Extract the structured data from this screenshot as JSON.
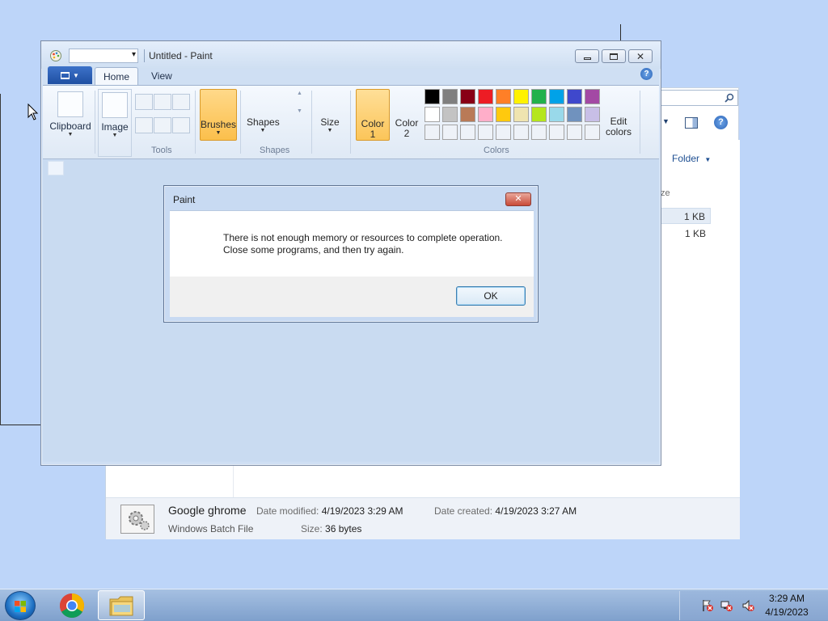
{
  "explorer": {
    "folder_label": "Folder",
    "column_size": "ze",
    "rows": [
      {
        "size": "1 KB",
        "selected": true
      },
      {
        "size": "1 KB",
        "selected": false
      }
    ],
    "details": {
      "name": "Google ghrome",
      "type": "Windows Batch File",
      "date_modified_label": "Date modified:",
      "date_modified": "4/19/2023 3:29 AM",
      "date_created_label": "Date created:",
      "date_created": "4/19/2023 3:27 AM",
      "size_label": "Size:",
      "size": "36 bytes"
    }
  },
  "paint": {
    "title": "Untitled - Paint",
    "tabs": {
      "home": "Home",
      "view": "View"
    },
    "help": "?",
    "ribbon": {
      "clipboard": "Clipboard",
      "image": "Image",
      "tools": "Tools",
      "brushes": "Brushes",
      "shapes": "Shapes",
      "shapes_group": "Shapes",
      "size": "Size",
      "color1_line1": "Color",
      "color1_line2": "1",
      "color2_line1": "Color",
      "color2_line2": "2",
      "colors_group": "Colors",
      "edit_colors_line1": "Edit",
      "edit_colors_line2": "colors"
    },
    "palette": [
      [
        "#000000",
        "#7f7f7f",
        "#880015",
        "#ed1c24",
        "#ff7f27",
        "#fff200",
        "#22b14c",
        "#00a2e8",
        "#3f48cc",
        "#a349a4"
      ],
      [
        "#ffffff",
        "#c3c3c3",
        "#b97a57",
        "#ffaec9",
        "#ffc90e",
        "#efe4b0",
        "#b5e61d",
        "#99d9ea",
        "#7092be",
        "#c8bfe7"
      ],
      [
        "#eef2f8",
        "#eef2f8",
        "#eef2f8",
        "#eef2f8",
        "#eef2f8",
        "#eef2f8",
        "#eef2f8",
        "#eef2f8",
        "#eef2f8",
        "#eef2f8"
      ]
    ]
  },
  "dialog": {
    "title": "Paint",
    "message_line1": "There is not enough memory or resources to complete operation.",
    "message_line2": "Close some programs, and then try again.",
    "ok_label": "OK",
    "close_glyph": "✕"
  },
  "taskbar": {
    "time": "3:29 AM",
    "date": "4/19/2023"
  }
}
